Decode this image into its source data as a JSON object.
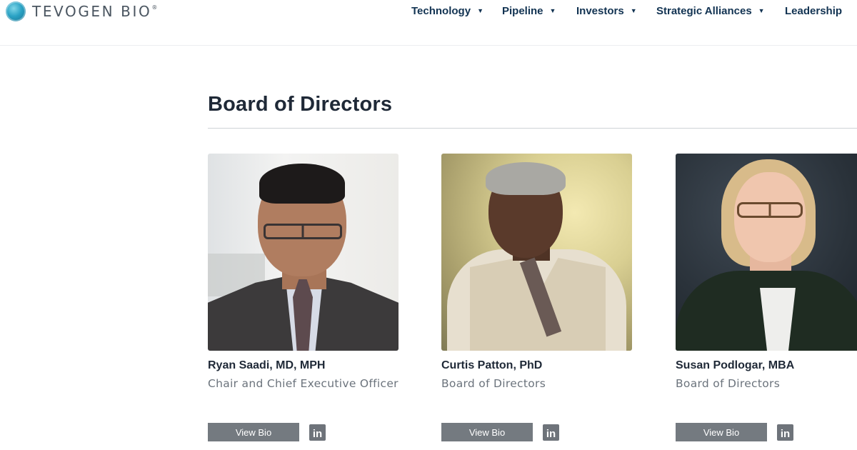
{
  "header": {
    "logo_text": "TEVOGEN BIO",
    "logo_mark": "®",
    "nav": [
      {
        "label": "Technology",
        "has_dropdown": true
      },
      {
        "label": "Pipeline",
        "has_dropdown": true
      },
      {
        "label": "Investors",
        "has_dropdown": true
      },
      {
        "label": "Strategic Alliances",
        "has_dropdown": true
      },
      {
        "label": "Leadership",
        "has_dropdown": false
      }
    ],
    "caret_icon": "▼"
  },
  "section": {
    "title": "Board of Directors"
  },
  "members": [
    {
      "name": "Ryan Saadi, MD, MPH",
      "role": "Chair and Chief Executive Officer",
      "button": "View Bio",
      "social_icon": "linkedin-icon",
      "social_glyph": "in"
    },
    {
      "name": "Curtis Patton, PhD",
      "role": "Board of Directors",
      "button": "View Bio",
      "social_icon": "linkedin-icon",
      "social_glyph": "in"
    },
    {
      "name": "Susan Podlogar, MBA",
      "role": "Board of Directors",
      "button": "View Bio",
      "social_icon": "linkedin-icon",
      "social_glyph": "in"
    }
  ],
  "colors": {
    "nav_text": "#123352",
    "heading": "#1f2937",
    "button_bg": "#747a80",
    "role_text": "#6b737c"
  }
}
